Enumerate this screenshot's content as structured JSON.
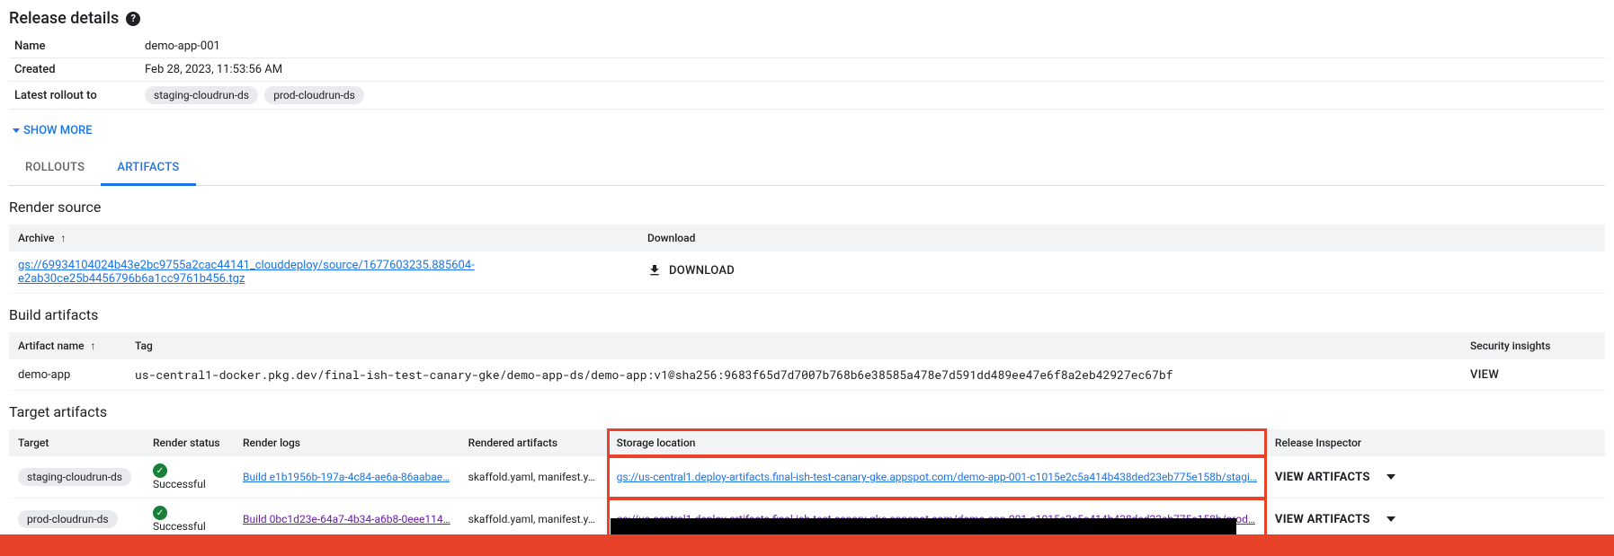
{
  "header": {
    "title": "Release details"
  },
  "details": {
    "name_label": "Name",
    "name_value": "demo-app-001",
    "created_label": "Created",
    "created_value": "Feb 28, 2023, 11:53:56 AM",
    "rollout_label": "Latest rollout to",
    "rollout_targets": [
      "staging-cloudrun-ds",
      "prod-cloudrun-ds"
    ],
    "show_more": "SHOW MORE"
  },
  "tabs": {
    "rollouts": "ROLLOUTS",
    "artifacts": "ARTIFACTS"
  },
  "render_source": {
    "title": "Render source",
    "col_archive": "Archive",
    "col_download": "Download",
    "archive_url": "gs://69934104024b43e2bc9755a2cac44141_clouddeploy/source/1677603235.885604-e2ab30ce25b4456796b6a1cc9761b456.tgz",
    "download_label": "DOWNLOAD"
  },
  "build_artifacts": {
    "title": "Build artifacts",
    "col_name": "Artifact name",
    "col_tag": "Tag",
    "col_insights": "Security insights",
    "rows": [
      {
        "name": "demo-app",
        "tag": "us-central1-docker.pkg.dev/final-ish-test-canary-gke/demo-app-ds/demo-app:v1@sha256:9683f65d7d7007b768b6e38585a478e7d591dd489ee47e6f8a2eb42927ec67bf",
        "view": "VIEW"
      }
    ]
  },
  "target_artifacts": {
    "title": "Target artifacts",
    "col_target": "Target",
    "col_status": "Render status",
    "col_logs": "Render logs",
    "col_rendered": "Rendered artifacts",
    "col_storage": "Storage location",
    "col_inspector": "Release Inspector",
    "rows": [
      {
        "target": "staging-cloudrun-ds",
        "status": "Successful",
        "logs": "Build e1b1956b-197a-4c84-ae6a-86aabae…",
        "rendered": "skaffold.yaml, manifest.y…",
        "storage": "gs://us-central1.deploy-artifacts.final-ish-test-canary-gke.appspot.com/demo-app-001-c1015e2c5a414b438ded23eb775e158b/stagi…",
        "inspector": "VIEW ARTIFACTS"
      },
      {
        "target": "prod-cloudrun-ds",
        "status": "Successful",
        "logs": "Build 0bc1d23e-64a7-4b34-a6b8-0eee114…",
        "rendered": "skaffold.yaml, manifest.y…",
        "storage": "gs://us-central1.deploy-artifacts.final-ish-test-canary-gke.appspot.com/demo-app-001-c1015e2c5a414b438ded23eb775e158b/prod…",
        "inspector": "VIEW ARTIFACTS"
      }
    ]
  }
}
